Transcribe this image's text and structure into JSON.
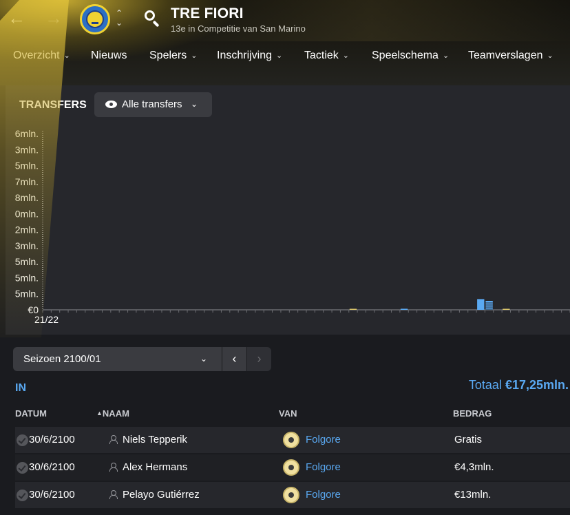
{
  "header": {
    "back_icon": "arrow-left-icon",
    "forward_icon": "arrow-right-icon",
    "team_name": "TRE FIORI",
    "team_subtitle": "13e in Competitie van San Marino"
  },
  "menu": [
    {
      "label": "Overzicht",
      "chevron": true
    },
    {
      "label": "Nieuws",
      "chevron": false
    },
    {
      "label": "Spelers",
      "chevron": true
    },
    {
      "label": "Inschrijving",
      "chevron": true
    },
    {
      "label": "Tactiek",
      "chevron": true
    },
    {
      "label": "Speelschema",
      "chevron": true
    },
    {
      "label": "Teamverslagen",
      "chevron": true
    }
  ],
  "transfers": {
    "title": "TRANSFERS",
    "filter_label": "Alle transfers"
  },
  "chart_data": {
    "type": "bar",
    "title": "",
    "y_tick_labels": [
      "€0",
      "5mln.",
      "5mln.",
      "5mln.",
      "3mln.",
      "2mln.",
      "0mln.",
      "8mln.",
      "7mln.",
      "5mln.",
      "3mln.",
      "6mln."
    ],
    "x_first_label": "21/22",
    "visible_bars": [
      {
        "slot": 51,
        "value_fraction": 0.06,
        "color": "#5aa9f2",
        "style": "solid"
      },
      {
        "slot": 52,
        "value_fraction": 0.05,
        "color": "#5aa9f2",
        "style": "striped"
      },
      {
        "slot": 42,
        "value_fraction": 0.006,
        "color": "#5aa9f2",
        "style": "solid"
      },
      {
        "slot": 54,
        "value_fraction": 0.004,
        "color": "#d9c56a",
        "style": "solid"
      },
      {
        "slot": 36,
        "value_fraction": 0.003,
        "color": "#d9c56a",
        "style": "solid"
      }
    ]
  },
  "season": {
    "label": "Seizoen 2100/01"
  },
  "incoming": {
    "label": "IN",
    "total_label": "Totaal ",
    "total_value": "€17,25mln.",
    "columns": {
      "date": "DATUM",
      "name": "NAAM",
      "from": "VAN",
      "amount": "BEDRAG"
    },
    "rows": [
      {
        "date": "30/6/2100",
        "name": "Niels Tepperik",
        "club": "Folgore",
        "amount": "Gratis"
      },
      {
        "date": "30/6/2100",
        "name": "Alex Hermans",
        "club": "Folgore",
        "amount": "€4,3mln."
      },
      {
        "date": "30/6/2100",
        "name": "Pelayo Gutiérrez",
        "club": "Folgore",
        "amount": "€13mln."
      }
    ]
  }
}
